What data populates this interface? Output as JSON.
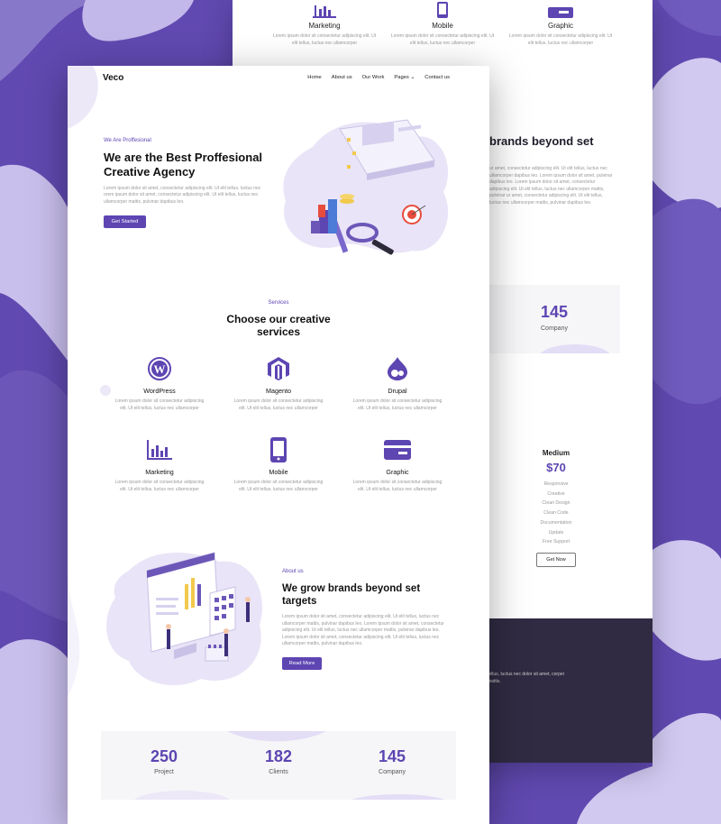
{
  "colors": {
    "accent": "#5d45b2",
    "background": "#6049b0",
    "footer": "#302b42"
  },
  "nav": {
    "logo": "Veco",
    "links": [
      "Home",
      "About us",
      "Our Work",
      "Pages",
      "Contact us"
    ]
  },
  "hero": {
    "eyebrow": "We Are Proffesional",
    "title": "We are the Best Proffesional Creative Agency",
    "text": "Lorem ipsum dolor sit amet, consectetur adipiscing elit. Ut elit tellus, luctus nec orem ipsum dolor sit amet, consectetur adipiscing elit. Ut elit tellus, luctus nec ullamcorper mattis, pulvinar dapibus leo.",
    "button": "Get Started"
  },
  "services": {
    "eyebrow": "Services",
    "title": "Choose our creative services",
    "items": [
      {
        "icon": "wordpress-icon",
        "title": "WordPress",
        "text": "Lorem ipsum dolor sit consectetur adipiscing elit. Ut elit tellus, luctus nec ullamcorper"
      },
      {
        "icon": "magento-icon",
        "title": "Magento",
        "text": "Lorem ipsum dolor sit consectetur adipiscing elit. Ut elit tellus, luctus nec ullamcorper"
      },
      {
        "icon": "drupal-icon",
        "title": "Drupal",
        "text": "Lorem ipsum dolor sit consectetur adipiscing elit. Ut elit tellus, luctus nec ullamcorper"
      },
      {
        "icon": "bar-chart-icon",
        "title": "Marketing",
        "text": "Lorem ipsum dolor sit consectetur adipiscing elit. Ut elit tellus, luctus nec ullamcorper"
      },
      {
        "icon": "mobile-icon",
        "title": "Mobile",
        "text": "Lorem ipsum dolor sit consectetur adipiscing elit. Ut elit tellus, luctus nec ullamcorper"
      },
      {
        "icon": "credit-card-icon",
        "title": "Graphic",
        "text": "Lorem ipsum dolor sit consectetur adipiscing elit. Ut elit tellus, luctus nec ullamcorper"
      }
    ]
  },
  "about": {
    "eyebrow": "About us",
    "title": "We grow brands beyond set targets",
    "text": "Lorem ipsum dolor sit amet, consectetur adipiscing elit. Ut elit tellus, luctus nec ullamcorper mattis, pulvinar dapibus leo. Lorem ipsum dolor sit amet, consectetur adipiscing elit. Ut elit tellus, luctus nec ullamcorper mattis, pulvinar dapibus leo. Lorem ipsum dolor sit amet, consectetur adipiscing elit. Ut elit tellus, luctus nec ullamcorper mattis, pulvinar dapibus leo.",
    "button": "Read More"
  },
  "stats": [
    {
      "value": "250",
      "label": "Project"
    },
    {
      "value": "182",
      "label": "Clients"
    },
    {
      "value": "145",
      "label": "Company"
    }
  ],
  "back_page": {
    "services": [
      {
        "icon": "bar-chart-icon",
        "title": "Marketing",
        "text": "Lorem ipsum dolor sit consectetur adipiscing elit. Ut elit tellus, luctus nec ullamcorper"
      },
      {
        "icon": "mobile-icon",
        "title": "Mobile",
        "text": "Lorem ipsum dolor sit consectetur adipiscing elit. Ut elit tellus, luctus nec ullamcorper"
      },
      {
        "icon": "credit-card-icon",
        "title": "Graphic",
        "text": "Lorem ipsum dolor sit consectetur adipiscing elit. Ut elit tellus, luctus nec ullamcorper"
      }
    ],
    "about_title": "brands beyond set",
    "about_text": "ur amet, consectetur adipiscing elit. Ut elit tellus, luctus nec ullamcorper dapibus leo. Lorem ipsum dolor sit amet, pulvinar dapibus leo. Lorem ipsum dolor sit amet, consectetur adipiscing elit. Ut elit tellus, luctus nec ullamcorper mattis, pulvinar ur amet, consectetur adipiscing elit. Ut elit tellus, luctus nec ullamcorper mattis, pulvinar dapibus leo.",
    "stat": {
      "value": "145",
      "label": "Company"
    },
    "pricing": {
      "plan": "Medium",
      "price": "$70",
      "features": [
        "Responsive",
        "Creative",
        "Clean Design",
        "Clean Code",
        "Documentation",
        "Update",
        "Free Support"
      ],
      "button": "Get Now"
    },
    "footer_text": "tellus, luctus nec dolor sit amet, corper mattis."
  }
}
